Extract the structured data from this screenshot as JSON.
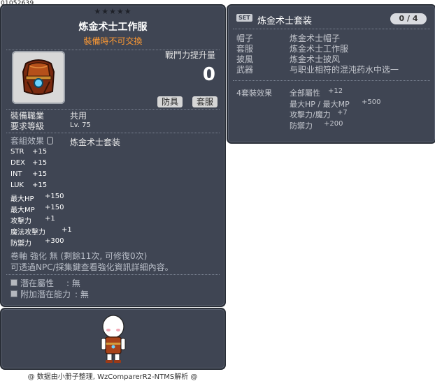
{
  "item_id": "01052639",
  "item": {
    "stars": "★★★★★",
    "name": "炼金术士工作服",
    "trade_note": "裝備時不可交換",
    "attack_gain_label": "戰鬥力提升量",
    "attack_gain_value": "0",
    "tags": [
      "防具",
      "套服"
    ],
    "job_label": "裝備職業",
    "job_value": "共用",
    "req_level_label": "要求等級",
    "req_level_value": "Lv. 75",
    "set_label": "套組效果",
    "set_value": "炼金术士套装",
    "stats": [
      {
        "name": "STR",
        "value": "+15"
      },
      {
        "name": "DEX",
        "value": "+15"
      },
      {
        "name": "INT",
        "value": "+15"
      },
      {
        "name": "LUK",
        "value": "+15"
      },
      {
        "name": "最大HP",
        "value": "+150"
      },
      {
        "name": "最大MP",
        "value": "+150"
      },
      {
        "name": "攻擊力",
        "value": "+1"
      },
      {
        "name": "魔法攻擊力",
        "value": "+1"
      },
      {
        "name": "防禦力",
        "value": "+300"
      }
    ],
    "scroll_line": "卷軸 強化 無 (剩餘11次, 可修復0次)",
    "scroll_hint": "可透過NPC/採集鍵查看強化資訊詳細內容。",
    "potential_label": "潛在屬性",
    "potential_value": "無",
    "bonus_potential_label": "附加潛在能力",
    "bonus_potential_value": "無"
  },
  "set_panel": {
    "badge": "SET",
    "name": "炼金术士套装",
    "count": "0 / 4",
    "pieces": [
      {
        "slot": "帽子",
        "name": "炼金术士帽子"
      },
      {
        "slot": "套服",
        "name": "炼金术士工作服"
      },
      {
        "slot": "披風",
        "name": "炼金术士披风"
      },
      {
        "slot": "武器",
        "name": "与职业相符的混沌药水中选一"
      }
    ],
    "effect_label": "4套裝效果",
    "effects": [
      {
        "name": "全部屬性",
        "value": "+12"
      },
      {
        "name": "最大HP / 最大MP",
        "value": "+500"
      },
      {
        "name": "攻擊力/魔力",
        "value": "+7"
      },
      {
        "name": "防禦力",
        "value": "+200"
      }
    ]
  },
  "footer": "@ 数据由小册子整理, WzComparerR2-NTMS解析 @",
  "colors": {
    "panel_bg": "#3f4553",
    "trade_note": "#ff9a33",
    "title": "#ffffff"
  },
  "icons": [
    "item-armor-icon",
    "lock-icon",
    "set-badge",
    "character-avatar"
  ]
}
